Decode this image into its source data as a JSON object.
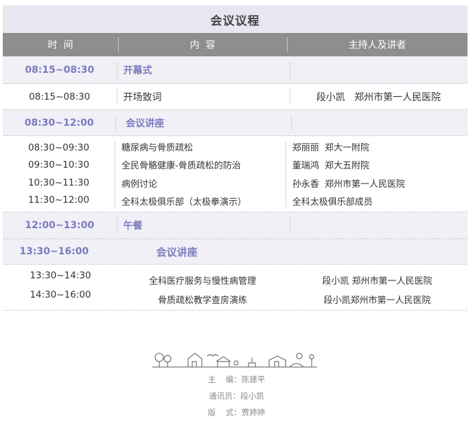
{
  "title": "会议议程",
  "header": {
    "time": "时  间",
    "content": "内  容",
    "speaker": "主持人及讲者"
  },
  "sections": [
    {
      "time": "08:15~08:30",
      "title": "开幕式",
      "rows": [
        {
          "time": "08:15~08:30",
          "content": "开场致词",
          "speaker": "段小凯   郑州市第一人民医院"
        }
      ]
    },
    {
      "time": "08:30~12:00",
      "title": "会议讲座",
      "rows": [
        {
          "time": "08:30~09:30",
          "content": "糖尿病与骨质疏松",
          "speaker": "郑丽丽  郑大一附院"
        },
        {
          "time": "09:30~10:30",
          "content": "全民骨骼健康-骨质疏松的防治",
          "speaker": "董瑞鸿  郑大五附院"
        },
        {
          "time": "10:30~11:30",
          "content": "病例讨论",
          "speaker": "孙永香  郑州市第一人民医院"
        },
        {
          "time": "11:30~12:00",
          "content": "全科太极俱乐部（太极拳演示）",
          "speaker": "全科太极俱乐部成员"
        }
      ]
    },
    {
      "time": "12:00~13:00",
      "title": "午餐",
      "rows": []
    },
    {
      "time": "13:30~16:00",
      "title": "会议讲座",
      "rows": [
        {
          "time": "13:30~14:30",
          "content": "全科医疗服务与慢性病管理",
          "speaker": "段小凯 郑州市第一人民医院"
        },
        {
          "time": "14:30~16:00",
          "content": "骨质疏松教学查房演练",
          "speaker": "段小凯郑州市第一人民医院"
        }
      ]
    }
  ],
  "credits": {
    "editor": "主    编：陈建平",
    "reporter": "通讯员：段小凯",
    "layout": "版    式：贾婷婷"
  },
  "colors": {
    "title_bg": "#e8e6f0",
    "header_bg": "#8e8e8e",
    "section_bg": "#f1f0f7",
    "accent": "#7b7bbf"
  }
}
